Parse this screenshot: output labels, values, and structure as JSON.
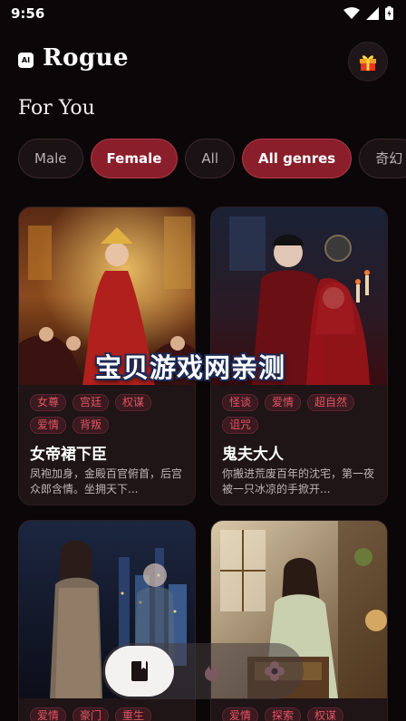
{
  "status": {
    "time": "9:56"
  },
  "header": {
    "badge": "AI",
    "title": "Rogue"
  },
  "section": {
    "title": "For You"
  },
  "filters": [
    {
      "label": "Male",
      "active": false
    },
    {
      "label": "Female",
      "active": true
    },
    {
      "label": "All",
      "active": false
    },
    {
      "label": "All genres",
      "active": true
    },
    {
      "label": "奇幻",
      "active": false
    }
  ],
  "cards": [
    {
      "tags": [
        "女尊",
        "宫廷",
        "权谋",
        "爱情",
        "背叛"
      ],
      "title": "女帝裙下臣",
      "desc": "凤袍加身，金殿百官俯首，后宫众郎含情。坐拥天下..."
    },
    {
      "tags": [
        "怪谈",
        "爱情",
        "超自然",
        "诅咒"
      ],
      "title": "鬼夫大人",
      "desc": "你搬进荒废百年的沈宅，第一夜被一只冰凉的手掀开..."
    },
    {
      "tags": [
        "爱情",
        "豪门",
        "重生"
      ]
    },
    {
      "tags": [
        "爱情",
        "探索",
        "权谋"
      ]
    }
  ],
  "watermark": "宝贝游戏网亲测",
  "colors": {
    "accent": "#8a1f2b",
    "tag": "#e05564",
    "background": "#0b0708"
  }
}
